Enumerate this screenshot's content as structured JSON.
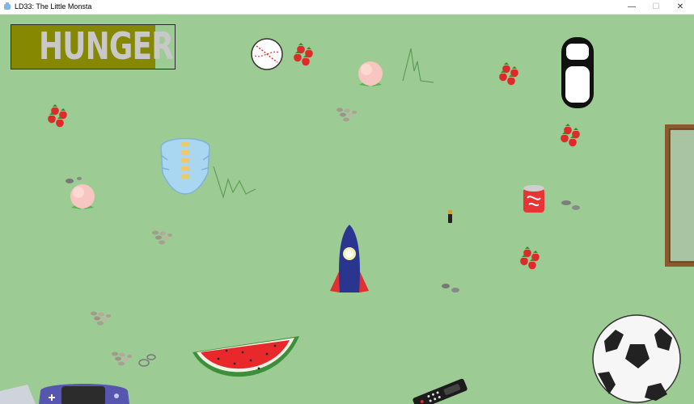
{
  "window": {
    "title": "LD33: The Little Monsta",
    "controls": {
      "minimize": "—",
      "maximize": "☐",
      "close": "✕"
    }
  },
  "hud": {
    "hunger_label": "HUNGER",
    "hunger_level": 0.88,
    "hunger_color": "#858800"
  },
  "scene": {
    "background_color": "#9ccc93",
    "objects": [
      "baseball",
      "strawberries",
      "peach",
      "scribble",
      "car",
      "stones",
      "blue-monster",
      "rocket",
      "soda-can",
      "cigarette",
      "picture-frame",
      "watermelon",
      "soccer-ball",
      "tv-remote",
      "game-console"
    ]
  }
}
